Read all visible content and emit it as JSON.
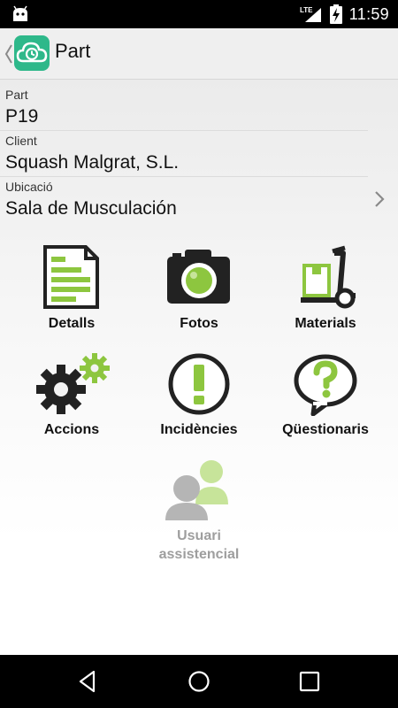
{
  "status_bar": {
    "network": "LTE",
    "time": "11:59"
  },
  "app_bar": {
    "title": "Part"
  },
  "fields": [
    {
      "label": "Part",
      "value": "P19"
    },
    {
      "label": "Client",
      "value": "Squash Malgrat, S.L."
    },
    {
      "label": "Ubicació",
      "value": "Sala de Musculación"
    }
  ],
  "tiles": [
    {
      "label": "Detalls",
      "icon": "document-icon"
    },
    {
      "label": "Fotos",
      "icon": "camera-icon"
    },
    {
      "label": "Materials",
      "icon": "hand-truck-icon"
    },
    {
      "label": "Accions",
      "icon": "gears-icon"
    },
    {
      "label": "Incidències",
      "icon": "exclamation-icon"
    },
    {
      "label": "Qüestionaris",
      "icon": "question-bubble-icon"
    },
    {
      "label_line1": "Usuari",
      "label_line2": "assistencial",
      "icon": "users-icon",
      "disabled": true
    }
  ],
  "colors": {
    "accent": "#2eb88a",
    "icon_green": "#8dc63f",
    "icon_dark": "#222222",
    "disabled": "#9e9e9e"
  }
}
